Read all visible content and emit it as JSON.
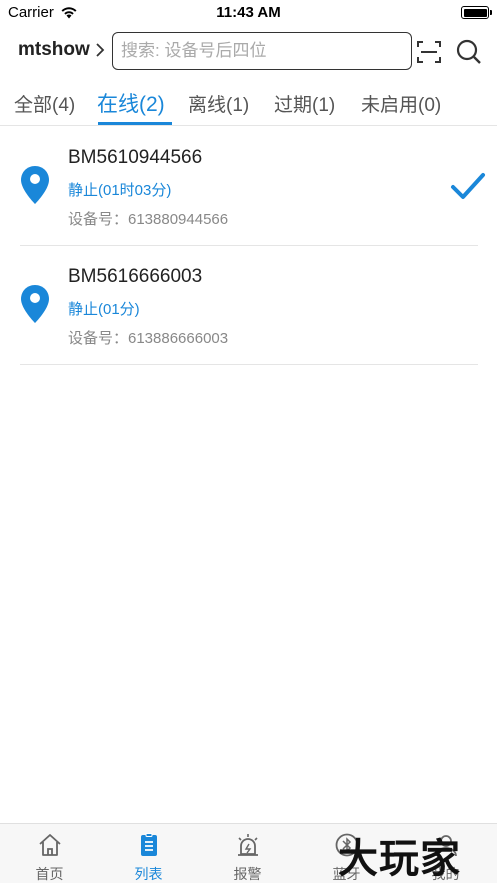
{
  "status_bar": {
    "carrier": "Carrier",
    "time": "11:43 AM"
  },
  "nav": {
    "account": "mtshow",
    "search_placeholder": "搜索: 设备号后四位"
  },
  "tabs": [
    {
      "label": "全部(4)"
    },
    {
      "label": "在线(2)"
    },
    {
      "label": "离线(1)"
    },
    {
      "label": "过期(1)"
    },
    {
      "label": "未启用(0)"
    }
  ],
  "devices": [
    {
      "name": "BM5610944566",
      "status": "静止(01时03分)",
      "device_no": "设备号：613880944566"
    },
    {
      "name": "BM5616666003",
      "status": "静止(01分)",
      "device_no": "设备号：613886666003"
    }
  ],
  "bottom_tabs": [
    {
      "label": "首页",
      "icon": "home-icon"
    },
    {
      "label": "列表",
      "icon": "list-icon"
    },
    {
      "label": "报警",
      "icon": "alarm-icon"
    },
    {
      "label": "蓝牙",
      "icon": "bluetooth-icon"
    },
    {
      "label": "我的",
      "icon": "profile-icon"
    }
  ],
  "watermark": "大玩家",
  "colors": {
    "accent": "#1a87d9",
    "text": "#222222",
    "muted": "#888888"
  }
}
